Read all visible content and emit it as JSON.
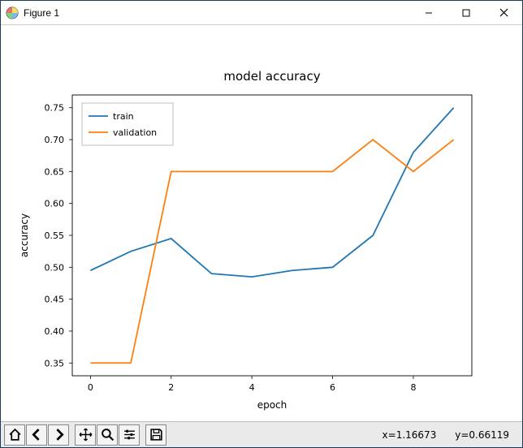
{
  "window": {
    "title": "Figure 1"
  },
  "toolbar": {
    "home": "home-icon",
    "back": "back-icon",
    "forward": "forward-icon",
    "pan": "pan-icon",
    "zoom": "zoom-icon",
    "configure": "configure-icon",
    "save": "save-icon"
  },
  "status": {
    "coords": "x=1.16673      y=0.66119"
  },
  "chart_data": {
    "type": "line",
    "title": "model accuracy",
    "xlabel": "epoch",
    "ylabel": "accuracy",
    "x": [
      0,
      1,
      2,
      3,
      4,
      5,
      6,
      7,
      8,
      9
    ],
    "series": [
      {
        "name": "train",
        "color": "#1f77b4",
        "values": [
          0.495,
          0.525,
          0.545,
          0.49,
          0.485,
          0.495,
          0.5,
          0.55,
          0.68,
          0.75
        ]
      },
      {
        "name": "validation",
        "color": "#ff7f0e",
        "values": [
          0.35,
          0.35,
          0.65,
          0.65,
          0.65,
          0.65,
          0.65,
          0.7,
          0.65,
          0.7
        ]
      }
    ],
    "xlim": [
      -0.45,
      9.45
    ],
    "ylim": [
      0.33,
      0.77
    ],
    "xticks": [
      0,
      2,
      4,
      6,
      8
    ],
    "yticks": [
      0.35,
      0.4,
      0.45,
      0.5,
      0.55,
      0.6,
      0.65,
      0.7,
      0.75
    ],
    "ytick_labels": [
      "0.35",
      "0.40",
      "0.45",
      "0.50",
      "0.55",
      "0.60",
      "0.65",
      "0.70",
      "0.75"
    ],
    "legend_pos": "upper left"
  }
}
